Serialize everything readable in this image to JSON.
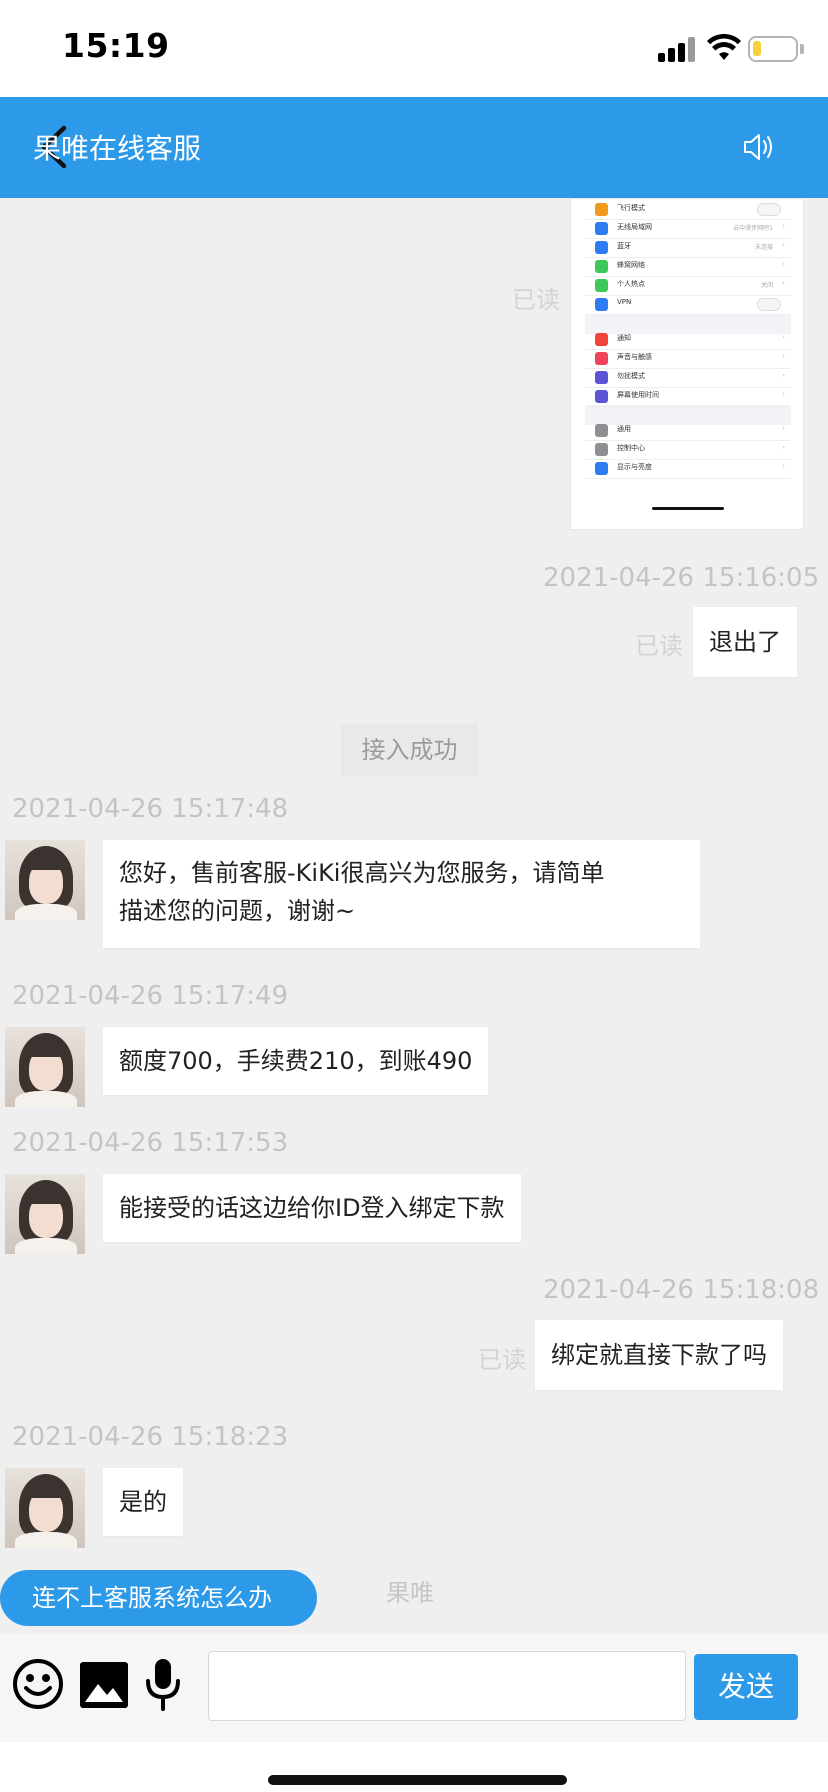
{
  "status_bar": {
    "time": "15:19"
  },
  "header": {
    "title": "果唯在线客服"
  },
  "screenshot_image": {
    "rows": [
      {
        "label": "飞行模式",
        "value": "",
        "control": "toggle",
        "color": "#f29a1b"
      },
      {
        "label": "无线局域网",
        "value": "云中漫步网吧1",
        "control": "chevron",
        "color": "#2d7cf6"
      },
      {
        "label": "蓝牙",
        "value": "未连接",
        "control": "chevron",
        "color": "#2d7cf6"
      },
      {
        "label": "蜂窝网络",
        "value": "",
        "control": "chevron",
        "color": "#3cc85a"
      },
      {
        "label": "个人热点",
        "value": "关闭",
        "control": "chevron",
        "color": "#3cc85a"
      },
      {
        "label": "VPN",
        "value": "",
        "control": "toggle",
        "color": "#2d7cf6"
      },
      {
        "label": "通知",
        "value": "",
        "control": "chevron",
        "color": "#f0443a"
      },
      {
        "label": "声音与触感",
        "value": "",
        "control": "chevron",
        "color": "#f0445a"
      },
      {
        "label": "勿扰模式",
        "value": "",
        "control": "chevron",
        "color": "#5b55d6"
      },
      {
        "label": "屏幕使用时间",
        "value": "",
        "control": "chevron",
        "color": "#5b55d6"
      },
      {
        "label": "通用",
        "value": "",
        "control": "chevron",
        "color": "#8e8e93"
      },
      {
        "label": "控制中心",
        "value": "",
        "control": "chevron",
        "color": "#8e8e93"
      },
      {
        "label": "显示与亮度",
        "value": "",
        "control": "chevron",
        "color": "#2d7cf6"
      }
    ]
  },
  "messages": [
    {
      "read": "已读"
    },
    {
      "time": "2021-04-26 15:16:05",
      "read": "已读",
      "text": "退出了"
    },
    {
      "notice": "接入成功"
    },
    {
      "time": "2021-04-26 15:17:48",
      "line1": "您好，售前客服-KiKi很高兴为您服务，请简单",
      "line2": "描述您的问题，谢谢~"
    },
    {
      "time": "2021-04-26 15:17:49",
      "text": "额度700，手续费210，到账490"
    },
    {
      "time": "2021-04-26 15:17:53",
      "text": "能接受的话这边给你ID登入绑定下款"
    },
    {
      "time": "2021-04-26 15:18:08",
      "read": "已读",
      "text": "绑定就直接下款了吗"
    },
    {
      "time": "2021-04-26 15:18:23",
      "text": "是的"
    }
  ],
  "help_chip": "连不上客服系统怎么办",
  "footer_brand": "果唯",
  "input": {
    "placeholder": "",
    "send_label": "发送"
  },
  "colors": {
    "accent": "#2d9ae9",
    "background": "#efefef"
  },
  "icons": [
    "back-arrow-icon",
    "speaker-icon",
    "emoji-icon",
    "image-icon",
    "microphone-icon"
  ]
}
